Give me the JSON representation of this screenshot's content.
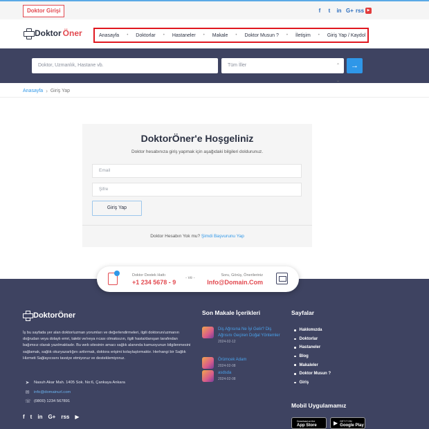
{
  "topbar": {
    "doktor_giris": "Doktor Girişi",
    "social": [
      "f",
      "t",
      "in",
      "G+",
      "rss",
      "▶"
    ]
  },
  "header": {
    "logo_part1": "Doktor",
    "logo_part2": "Öner",
    "nav": [
      "Anasayfa",
      "Doktorlar",
      "Hastaneler",
      "Makale",
      "Doktor Musun ?",
      "İletişim",
      "Giriş Yap / Kaydol"
    ]
  },
  "search": {
    "placeholder": "Doktor, Uzmanlık, Hastane vb.",
    "city_selected": "Tüm İller",
    "button_icon": "→"
  },
  "breadcrumb": {
    "home": "Anasayfa",
    "current": "Giriş Yap"
  },
  "login": {
    "title": "DoktorÖner'e Hoşgeliniz",
    "subtitle": "Doktor hesabınıza giriş yapmak için aşağıdaki bilgileri doldurunuz.",
    "email_placeholder": "Email",
    "password_placeholder": "Şifre",
    "button": "Giriş Yap",
    "no_account": "Doktor Hesabın Yok mu?",
    "apply_link": "Şimdi Başvurunu Yap"
  },
  "support": {
    "label1": "Doktor Destek Hattı",
    "phone": "+1 234 5678 - 9",
    "or": "- ve -",
    "label2": "Soru, Görüş, Önerileriniz",
    "email": "Info@Domain.Com"
  },
  "footer": {
    "logo": "DoktorÖner",
    "description": "İş bu sayfada yer alan doktor/uzman yorumları ve değerlendirmeleri, ilgili doktorun/uzmanın doğrudan veya dolaylı emri, talebi ve/veya rıcası olmaksızın, ilgili hasta/danışan tarafından bağımsız olarak yazılmaktadır. Bu web sitesinin amacı sağlık alanında kamuoyunun bilgilenmesini sağlamak, sağlık okuryazarlığını arttırmak, doktora erişimi kolaylaştırmaktır. Herhangi bir Sağlık Hizmeti Sağlayıcısını tavsiye etmiyoruz ve desteklemiyoruz.",
    "address": "Nasuh Akar Mah. 1405 Sok. No:6, Çankaya Ankara",
    "email": "info@domainurl.com",
    "phone": "(0800) 1234 567891",
    "social": [
      "f",
      "t",
      "in",
      "G+",
      "rss",
      "▶"
    ],
    "articles_title": "Son Makale İçerikleri",
    "articles": [
      {
        "title": "Diş Ağrısına Ne İyi Gelir? Diş Ağrısını Geçiren Doğal Yöntemler",
        "date": "2024-02-12"
      },
      {
        "title": "Örümcek Adam",
        "date": "2024-02-08"
      },
      {
        "title": "asdsda",
        "date": "2024-02-08"
      }
    ],
    "pages_title": "Sayfalar",
    "pages": [
      "Hakkımızda",
      "Doktorlar",
      "Hastaneler",
      "Blog",
      "Makaleler",
      "Doktor Musun ?",
      "Giriş"
    ],
    "mobile_title": "Mobil Uygulamamız",
    "appstore_small": "Download on the",
    "appstore_big": "App Store",
    "playstore_small": "GET IT ON",
    "playstore_big": "Google Play"
  }
}
